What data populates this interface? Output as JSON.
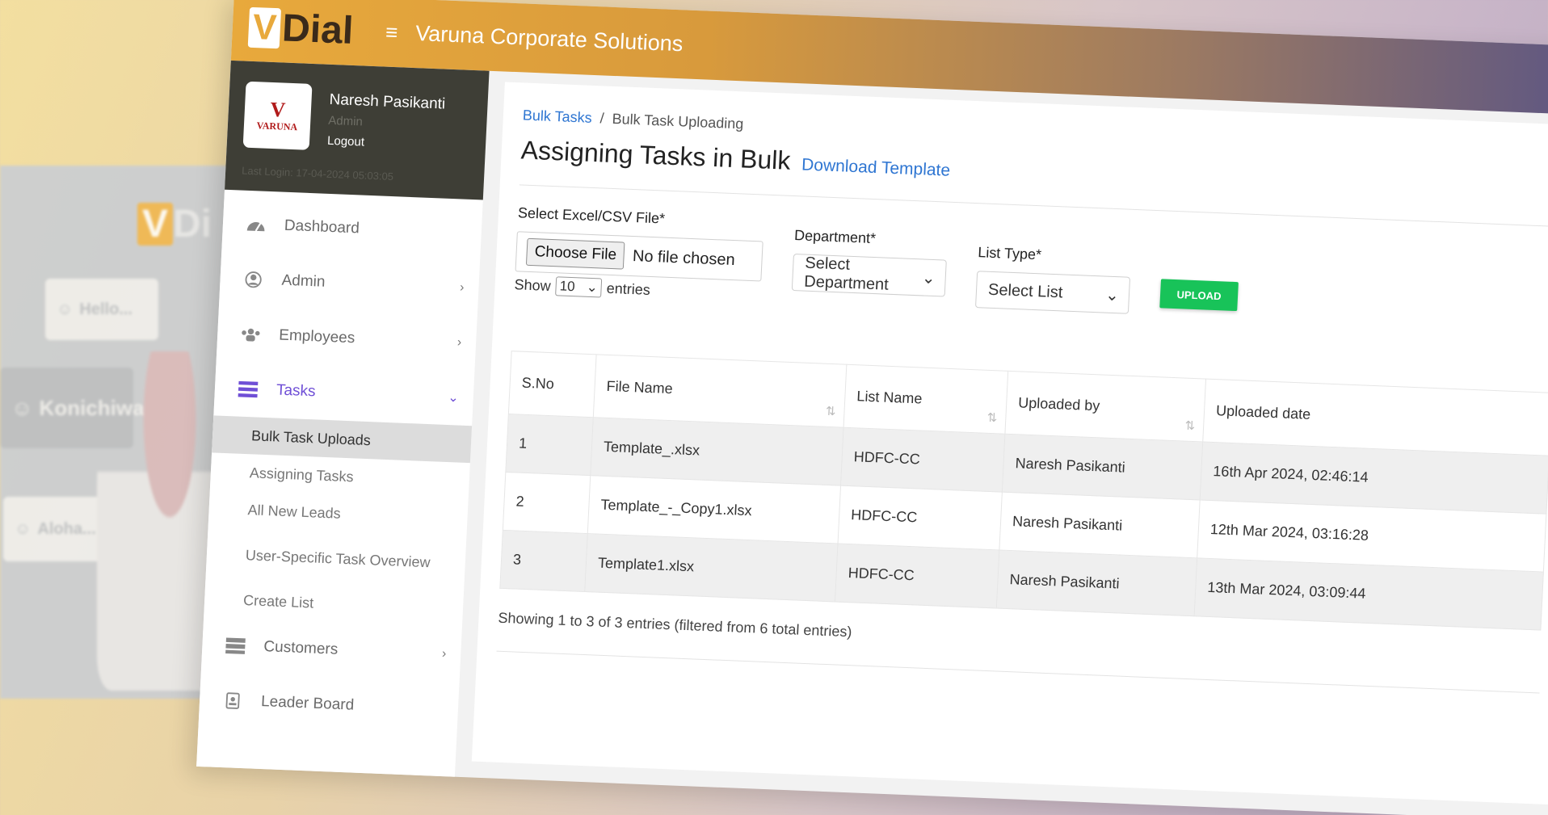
{
  "background": {
    "logo_v": "V",
    "logo_rest": "Di",
    "bubbles": [
      "Hello...",
      "Konichiwa",
      "Aloha..."
    ]
  },
  "app": {
    "brand_v": "V",
    "brand_rest": "Dial",
    "company": "Varuna Corporate Solutions",
    "colors": {
      "accent": "#e8a93c",
      "sidebar_profile": "#3e3e36",
      "active": "#6f4fd6",
      "link": "#2f76d2",
      "upload": "#18c359"
    }
  },
  "profile": {
    "logo_big": "V",
    "logo_small": "VARUNA",
    "name": "Naresh Pasikanti",
    "role": "Admin",
    "logout": "Logout",
    "last_login": "Last Login: 17-04-2024 05:03:05"
  },
  "nav": {
    "dashboard": "Dashboard",
    "admin": "Admin",
    "employees": "Employees",
    "tasks": "Tasks",
    "sub": {
      "bulk": "Bulk Task Uploads",
      "assigning": "Assigning Tasks",
      "leads": "All New Leads",
      "overview": "User-Specific Task Overview",
      "create": "Create List"
    },
    "customers": "Customers",
    "leader": "Leader Board"
  },
  "page": {
    "crumb_link": "Bulk Tasks",
    "crumb_sep": "/",
    "crumb_current": "Bulk Task Uploading",
    "title": "Assigning Tasks in Bulk",
    "download": "Download Template"
  },
  "form": {
    "file_label": "Select Excel/CSV File*",
    "file_button": "Choose File",
    "file_status": "No file chosen",
    "dept_label": "Department*",
    "dept_value": "Select Department",
    "list_label": "List Type*",
    "list_value": "Select List",
    "upload": "UPLOAD",
    "show": "Show",
    "show_value": "10",
    "entries": "entries"
  },
  "table": {
    "headers": [
      "S.No",
      "File Name",
      "List Name",
      "Uploaded by",
      "Uploaded date"
    ],
    "rows": [
      [
        "1",
        "Template_.xlsx",
        "HDFC-CC",
        "Naresh Pasikanti",
        "16th Apr 2024, 02:46:14"
      ],
      [
        "2",
        "Template_-_Copy1.xlsx",
        "HDFC-CC",
        "Naresh Pasikanti",
        "12th Mar 2024, 03:16:28"
      ],
      [
        "3",
        "Template1.xlsx",
        "HDFC-CC",
        "Naresh Pasikanti",
        "13th Mar 2024, 03:09:44"
      ]
    ],
    "footer": "Showing 1 to 3 of 3 entries (filtered from 6 total entries)"
  }
}
